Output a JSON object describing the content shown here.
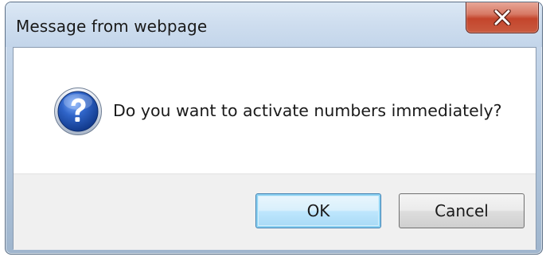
{
  "dialog": {
    "title": "Message from webpage",
    "message": "Do you want to activate numbers immediately?",
    "icon": "question-icon",
    "close_label": "",
    "buttons": {
      "ok_label": "OK",
      "cancel_label": "Cancel"
    }
  },
  "colors": {
    "close_button": "#c4452c",
    "icon_blue": "#2a5cb8",
    "default_button_border": "#3c7fb1"
  }
}
